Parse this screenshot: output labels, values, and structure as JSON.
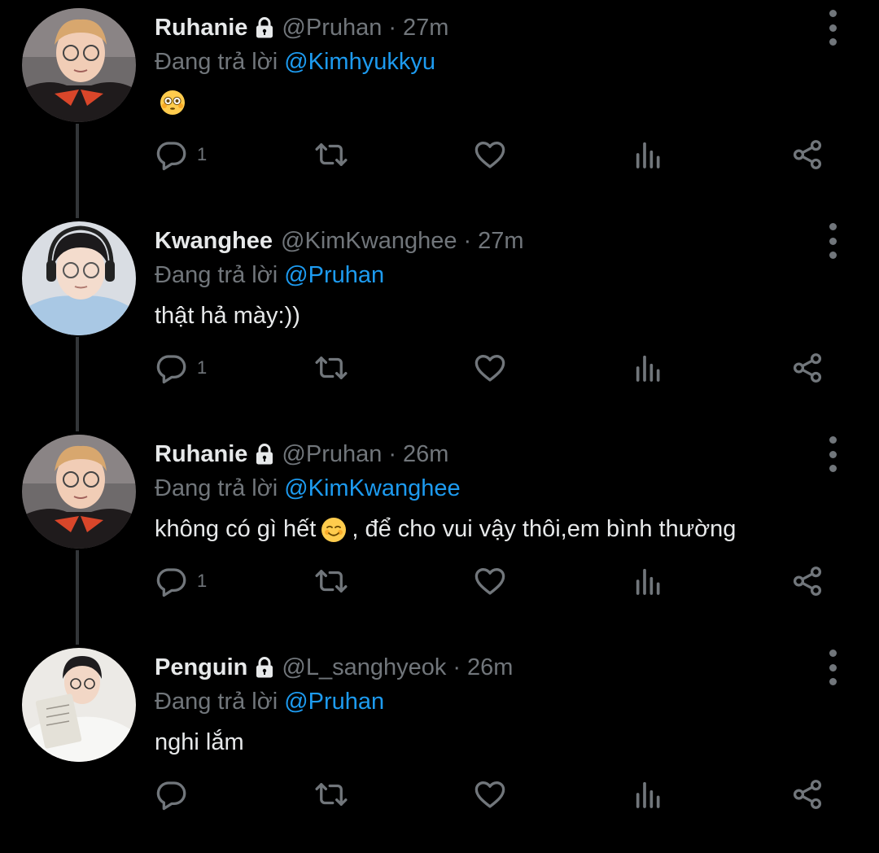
{
  "tweets": [
    {
      "name": "Ruhanie",
      "locked": true,
      "handle": "@Pruhan",
      "time": "27m",
      "reply_prefix": "Đang trả lời",
      "reply_to": "@Kimhyukkyu",
      "text_before": "",
      "emoji": "flushed-face",
      "text_after": "",
      "reply_count": "1",
      "avatar": "person-glasses-orange"
    },
    {
      "name": "Kwanghee",
      "locked": false,
      "handle": "@KimKwanghee",
      "time": "27m",
      "reply_prefix": "Đang trả lời",
      "reply_to": "@Pruhan",
      "text_before": "thật hả mày:))",
      "emoji": "",
      "text_after": "",
      "reply_count": "1",
      "avatar": "person-headset-blue"
    },
    {
      "name": "Ruhanie",
      "locked": true,
      "handle": "@Pruhan",
      "time": "26m",
      "reply_prefix": "Đang trả lời",
      "reply_to": "@KimKwanghee",
      "text_before": "không có gì hết",
      "emoji": "smiling-face",
      "text_after": ", để cho vui vậy thôi,em bình thường",
      "reply_count": "1",
      "avatar": "person-glasses-orange"
    },
    {
      "name": "Penguin",
      "locked": true,
      "handle": "@L_sanghyeok",
      "time": "26m",
      "reply_prefix": "Đang trả lời",
      "reply_to": "@Pruhan",
      "text_before": "nghi lắm",
      "emoji": "",
      "text_after": "",
      "reply_count": "",
      "avatar": "person-reading-book"
    }
  ],
  "separator": "·",
  "icons": [
    "reply-icon",
    "retweet-icon",
    "like-icon",
    "analytics-icon",
    "share-icon",
    "more-icon",
    "lock-icon"
  ],
  "colors": {
    "background": "#000000",
    "link": "#1d9bf0",
    "muted": "#71767b",
    "text": "#e7e9ea"
  }
}
